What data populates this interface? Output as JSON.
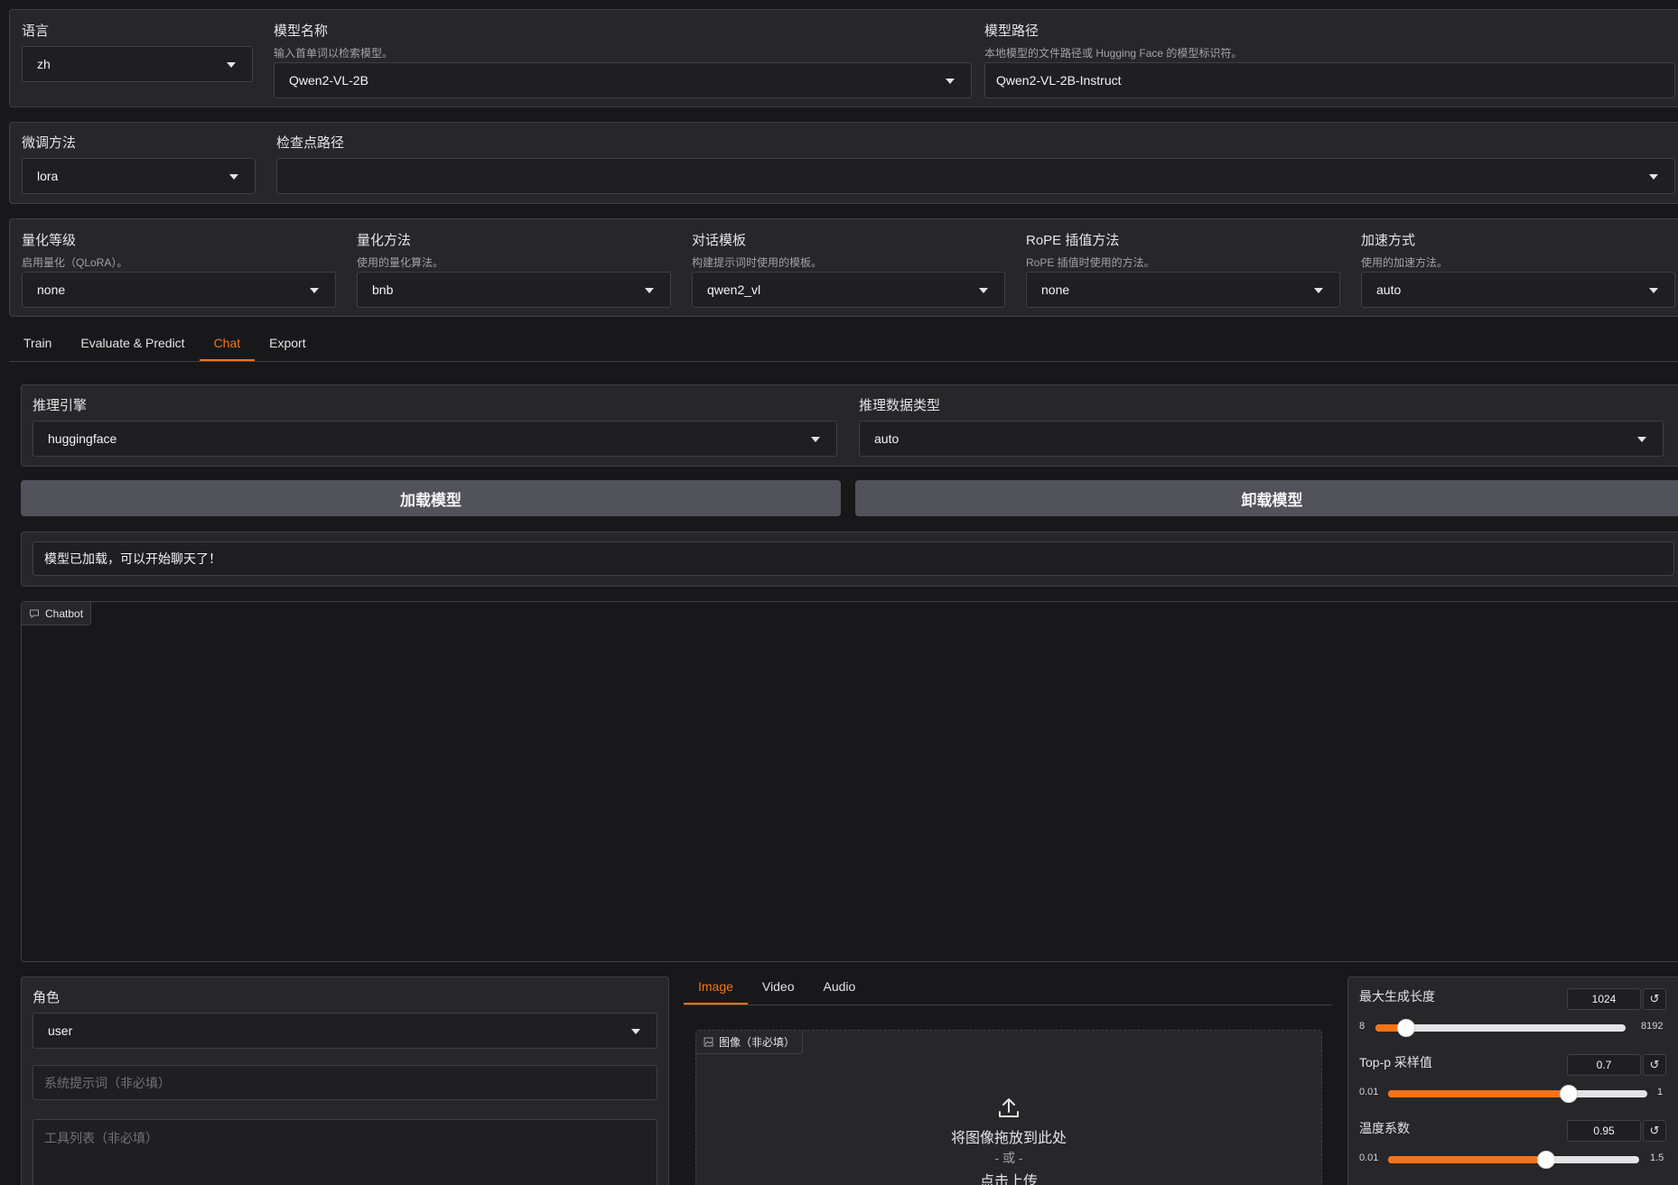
{
  "top": {
    "language": {
      "label": "语言",
      "value": "zh"
    },
    "model_name": {
      "label": "模型名称",
      "info": "输入首单词以检索模型。",
      "value": "Qwen2-VL-2B"
    },
    "model_path": {
      "label": "模型路径",
      "info": "本地模型的文件路径或 Hugging Face 的模型标识符。",
      "value": "Qwen2-VL-2B-Instruct"
    }
  },
  "finetune": {
    "method": {
      "label": "微调方法",
      "value": "lora"
    },
    "checkpoint": {
      "label": "检查点路径",
      "value": ""
    }
  },
  "advanced": {
    "quant_bit": {
      "label": "量化等级",
      "info": "启用量化（QLoRA）。",
      "value": "none"
    },
    "quant_method": {
      "label": "量化方法",
      "info": "使用的量化算法。",
      "value": "bnb"
    },
    "template": {
      "label": "对话模板",
      "info": "构建提示词时使用的模板。",
      "value": "qwen2_vl"
    },
    "rope": {
      "label": "RoPE 插值方法",
      "info": "RoPE 插值时使用的方法。",
      "value": "none"
    },
    "booster": {
      "label": "加速方式",
      "info": "使用的加速方法。",
      "value": "auto"
    }
  },
  "main_tabs": [
    {
      "label": "Train",
      "active": false
    },
    {
      "label": "Evaluate & Predict",
      "active": false
    },
    {
      "label": "Chat",
      "active": true
    },
    {
      "label": "Export",
      "active": false
    }
  ],
  "chat": {
    "infer_backend": {
      "label": "推理引擎",
      "value": "huggingface"
    },
    "infer_dtype": {
      "label": "推理数据类型",
      "value": "auto"
    },
    "load_button": "加载模型",
    "unload_button": "卸载模型",
    "status": "模型已加载，可以开始聊天了！",
    "chatbot_label": "Chatbot",
    "role": {
      "label": "角色",
      "value": "user"
    },
    "system_placeholder": "系统提示词（非必填）",
    "tools_placeholder": "工具列表（非必填）",
    "media_tabs": [
      {
        "label": "Image",
        "active": true
      },
      {
        "label": "Video",
        "active": false
      },
      {
        "label": "Audio",
        "active": false
      }
    ],
    "image_label": "图像（非必填）",
    "upload_drop": "将图像拖放到此处",
    "upload_or": "- 或 -",
    "upload_click": "点击上传"
  },
  "sliders": [
    {
      "label": "最大生成长度",
      "value": "1024",
      "min": "8",
      "max": "8192",
      "fraction": 0.124
    },
    {
      "label": "Top-p 采样值",
      "value": "0.7",
      "min": "0.01",
      "max": "1",
      "fraction": 0.697
    },
    {
      "label": "温度系数",
      "value": "0.95",
      "min": "0.01",
      "max": "1.5",
      "fraction": 0.631
    }
  ],
  "colors": {
    "accent": "#f97316",
    "panel": "#27272a",
    "background": "#18181b"
  }
}
